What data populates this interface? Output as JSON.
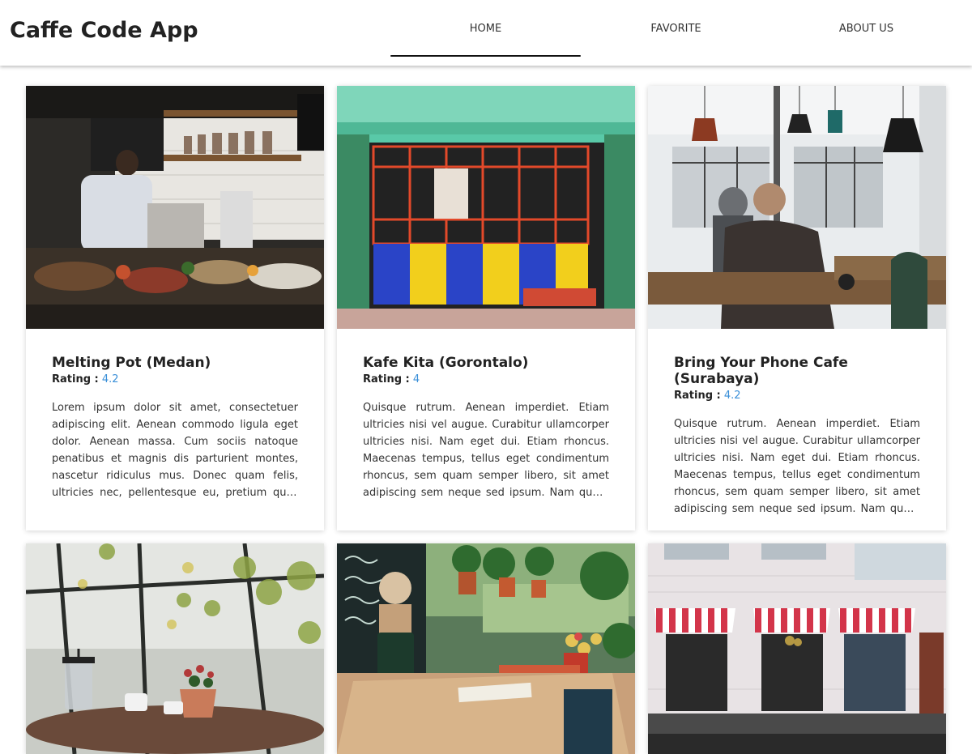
{
  "app": {
    "title": "Caffe Code App"
  },
  "nav": {
    "items": [
      {
        "label": "HOME"
      },
      {
        "label": "FAVORITE"
      },
      {
        "label": "ABOUT US"
      }
    ]
  },
  "rating_label": "Rating :",
  "cards": [
    {
      "name": "Melting Pot (Medan)",
      "rating": "4.2",
      "description": "Lorem ipsum dolor sit amet, consectetuer adipiscing elit. Aenean commodo ligula eget dolor. Aenean massa. Cum sociis natoque penatibus et magnis dis parturient montes, nascetur ridiculus mus. Donec quam felis, ultricies nec, pellentesque eu, pretium quis, sem."
    },
    {
      "name": "Kafe Kita (Gorontalo)",
      "rating": "4",
      "description": "Quisque rutrum. Aenean imperdiet. Etiam ultricies nisi vel augue. Curabitur ullamcorper ultricies nisi. Nam eget dui. Etiam rhoncus. Maecenas tempus, tellus eget condimentum rhoncus, sem quam semper libero, sit amet adipiscing sem neque sed ipsum. Nam quam nunc, blandit vel."
    },
    {
      "name": "Bring Your Phone Cafe (Surabaya)",
      "rating": "4.2",
      "description": "Quisque rutrum. Aenean imperdiet. Etiam ultricies nisi vel augue. Curabitur ullamcorper ultricies nisi. Nam eget dui. Etiam rhoncus. Maecenas tempus, tellus eget condimentum rhoncus, sem quam semper libero, sit amet adipiscing sem neque sed ipsum. Nam quam nunc, blandit vel."
    }
  ]
}
